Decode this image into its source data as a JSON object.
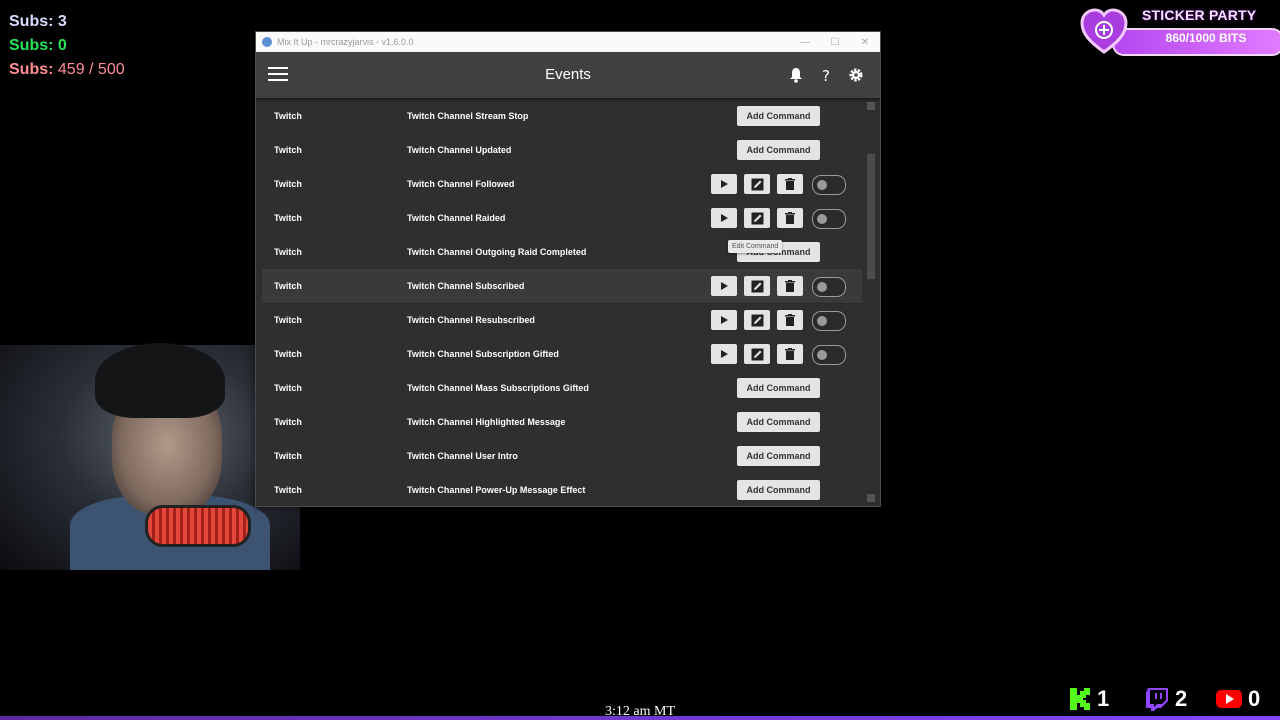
{
  "overlay": {
    "subs_line1": "Subs: 3",
    "subs_line2_label": "Subs: ",
    "subs_line2_value": "0",
    "subs_line3_label": "Subs: ",
    "subs_line3_value": "459 / 500"
  },
  "sticker": {
    "title": "STICKER PARTY",
    "bits": "860/1000 BITS",
    "progress": 0.86
  },
  "window": {
    "title": "Mix It Up - mrcrazyjarvis - v1.6.0.0",
    "min": "—",
    "max": "☐",
    "close": "✕"
  },
  "appbar": {
    "title": "Events"
  },
  "rows": [
    {
      "source": "Twitch",
      "event": "Twitch Channel Stream Stop",
      "type": "add",
      "add_label": "Add Command"
    },
    {
      "source": "Twitch",
      "event": "Twitch Channel Updated",
      "type": "add",
      "add_label": "Add Command"
    },
    {
      "source": "Twitch",
      "event": "Twitch Channel Followed",
      "type": "actions"
    },
    {
      "source": "Twitch",
      "event": "Twitch Channel Raided",
      "type": "actions"
    },
    {
      "source": "Twitch",
      "event": "Twitch Channel Outgoing Raid Completed",
      "type": "add",
      "add_label": "Add Command"
    },
    {
      "source": "Twitch",
      "event": "Twitch Channel Subscribed",
      "type": "actions"
    },
    {
      "source": "Twitch",
      "event": "Twitch Channel Resubscribed",
      "type": "actions"
    },
    {
      "source": "Twitch",
      "event": "Twitch Channel Subscription Gifted",
      "type": "actions"
    },
    {
      "source": "Twitch",
      "event": "Twitch Channel Mass Subscriptions Gifted",
      "type": "add",
      "add_label": "Add Command"
    },
    {
      "source": "Twitch",
      "event": "Twitch Channel Highlighted Message",
      "type": "add",
      "add_label": "Add Command"
    },
    {
      "source": "Twitch",
      "event": "Twitch Channel User Intro",
      "type": "add",
      "add_label": "Add Command"
    },
    {
      "source": "Twitch",
      "event": "Twitch Channel Power-Up Message Effect",
      "type": "add",
      "add_label": "Add Command"
    }
  ],
  "tooltip": "Edit Command",
  "clock": "3:12 am MT",
  "stats": {
    "kick": "1",
    "twitch": "2",
    "youtube": "0"
  },
  "colors": {
    "subs1": "#d8dcff",
    "subs2": "#26e35a",
    "subs3": "#ff8f95",
    "kick": "#53fc18",
    "twitch": "#9146ff",
    "youtube": "#ff0000"
  }
}
